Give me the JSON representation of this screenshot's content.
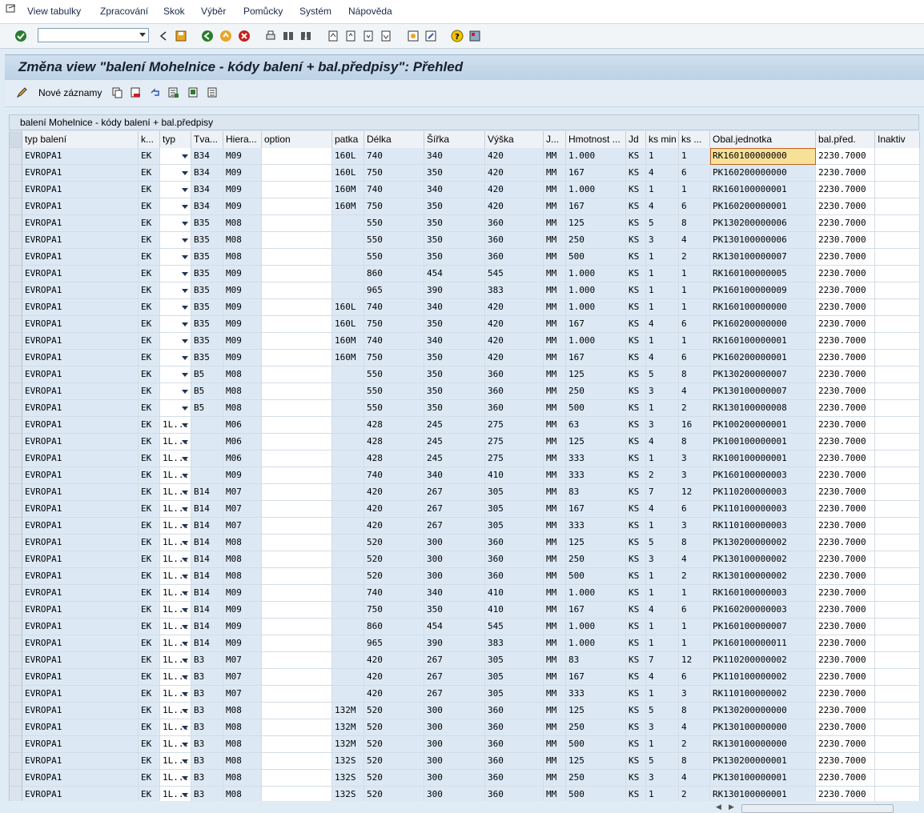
{
  "menu": {
    "items": [
      "View tabulky",
      "Zpracování",
      "Skok",
      "Výběr",
      "Pomůcky",
      "Systém",
      "Nápověda"
    ]
  },
  "toolbar": {
    "command_value": "",
    "icons": [
      "enter-icon",
      "back-icon",
      "save-icon",
      "back-nav-icon",
      "exit-icon",
      "cancel-icon",
      "print-icon",
      "find-icon",
      "find-next-icon",
      "first-page-icon",
      "prev-page-icon",
      "next-page-icon",
      "last-page-icon",
      "create-session-icon",
      "shortcut-icon",
      "help-icon",
      "customize-layout-icon"
    ]
  },
  "title": "Změna view \"balení Mohelnice - kódy balení + bal.předpisy\": Přehled",
  "app_toolbar": {
    "new_entries_label": "Nové záznamy"
  },
  "grid": {
    "title": "balení Mohelnice - kódy balení + bal.předpisy",
    "headers": [
      "typ balení",
      "k...",
      "typ",
      "Tva...",
      "Hiera...",
      "option",
      "patka",
      "Délka",
      "Šířka",
      "Výška",
      "J...",
      "Hmotnost ...",
      "Jd",
      "ks min",
      "ks ...",
      "Obal.jednotka",
      "bal.před.",
      "Inaktiv"
    ],
    "rows": [
      [
        "EVROPA1",
        "EK",
        "",
        "B34",
        "M09",
        "",
        "160L",
        "740",
        "340",
        "420",
        "MM",
        "1.000",
        "KS",
        "1",
        "1",
        "RK160100000000",
        "2230.7000",
        ""
      ],
      [
        "EVROPA1",
        "EK",
        "",
        "B34",
        "M09",
        "",
        "160L",
        "750",
        "350",
        "420",
        "MM",
        "167",
        "KS",
        "4",
        "6",
        "PK160200000000",
        "2230.7000",
        ""
      ],
      [
        "EVROPA1",
        "EK",
        "",
        "B34",
        "M09",
        "",
        "160M",
        "740",
        "340",
        "420",
        "MM",
        "1.000",
        "KS",
        "1",
        "1",
        "RK160100000001",
        "2230.7000",
        ""
      ],
      [
        "EVROPA1",
        "EK",
        "",
        "B34",
        "M09",
        "",
        "160M",
        "750",
        "350",
        "420",
        "MM",
        "167",
        "KS",
        "4",
        "6",
        "PK160200000001",
        "2230.7000",
        ""
      ],
      [
        "EVROPA1",
        "EK",
        "",
        "B35",
        "M08",
        "",
        "",
        "550",
        "350",
        "360",
        "MM",
        "125",
        "KS",
        "5",
        "8",
        "PK130200000006",
        "2230.7000",
        ""
      ],
      [
        "EVROPA1",
        "EK",
        "",
        "B35",
        "M08",
        "",
        "",
        "550",
        "350",
        "360",
        "MM",
        "250",
        "KS",
        "3",
        "4",
        "PK130100000006",
        "2230.7000",
        ""
      ],
      [
        "EVROPA1",
        "EK",
        "",
        "B35",
        "M08",
        "",
        "",
        "550",
        "350",
        "360",
        "MM",
        "500",
        "KS",
        "1",
        "2",
        "RK130100000007",
        "2230.7000",
        ""
      ],
      [
        "EVROPA1",
        "EK",
        "",
        "B35",
        "M09",
        "",
        "",
        "860",
        "454",
        "545",
        "MM",
        "1.000",
        "KS",
        "1",
        "1",
        "RK160100000005",
        "2230.7000",
        ""
      ],
      [
        "EVROPA1",
        "EK",
        "",
        "B35",
        "M09",
        "",
        "",
        "965",
        "390",
        "383",
        "MM",
        "1.000",
        "KS",
        "1",
        "1",
        "PK160100000009",
        "2230.7000",
        ""
      ],
      [
        "EVROPA1",
        "EK",
        "",
        "B35",
        "M09",
        "",
        "160L",
        "740",
        "340",
        "420",
        "MM",
        "1.000",
        "KS",
        "1",
        "1",
        "RK160100000000",
        "2230.7000",
        ""
      ],
      [
        "EVROPA1",
        "EK",
        "",
        "B35",
        "M09",
        "",
        "160L",
        "750",
        "350",
        "420",
        "MM",
        "167",
        "KS",
        "4",
        "6",
        "PK160200000000",
        "2230.7000",
        ""
      ],
      [
        "EVROPA1",
        "EK",
        "",
        "B35",
        "M09",
        "",
        "160M",
        "740",
        "340",
        "420",
        "MM",
        "1.000",
        "KS",
        "1",
        "1",
        "RK160100000001",
        "2230.7000",
        ""
      ],
      [
        "EVROPA1",
        "EK",
        "",
        "B35",
        "M09",
        "",
        "160M",
        "750",
        "350",
        "420",
        "MM",
        "167",
        "KS",
        "4",
        "6",
        "PK160200000001",
        "2230.7000",
        ""
      ],
      [
        "EVROPA1",
        "EK",
        "",
        "B5",
        "M08",
        "",
        "",
        "550",
        "350",
        "360",
        "MM",
        "125",
        "KS",
        "5",
        "8",
        "PK130200000007",
        "2230.7000",
        ""
      ],
      [
        "EVROPA1",
        "EK",
        "",
        "B5",
        "M08",
        "",
        "",
        "550",
        "350",
        "360",
        "MM",
        "250",
        "KS",
        "3",
        "4",
        "PK130100000007",
        "2230.7000",
        ""
      ],
      [
        "EVROPA1",
        "EK",
        "",
        "B5",
        "M08",
        "",
        "",
        "550",
        "350",
        "360",
        "MM",
        "500",
        "KS",
        "1",
        "2",
        "RK130100000008",
        "2230.7000",
        ""
      ],
      [
        "EVROPA1",
        "EK",
        "1L...",
        "",
        "M06",
        "",
        "",
        "428",
        "245",
        "275",
        "MM",
        "63",
        "KS",
        "3",
        "16",
        "PK100200000001",
        "2230.7000",
        ""
      ],
      [
        "EVROPA1",
        "EK",
        "1L...",
        "",
        "M06",
        "",
        "",
        "428",
        "245",
        "275",
        "MM",
        "125",
        "KS",
        "4",
        "8",
        "PK100100000001",
        "2230.7000",
        ""
      ],
      [
        "EVROPA1",
        "EK",
        "1L...",
        "",
        "M06",
        "",
        "",
        "428",
        "245",
        "275",
        "MM",
        "333",
        "KS",
        "1",
        "3",
        "RK100100000001",
        "2230.7000",
        ""
      ],
      [
        "EVROPA1",
        "EK",
        "1L...",
        "",
        "M09",
        "",
        "",
        "740",
        "340",
        "410",
        "MM",
        "333",
        "KS",
        "2",
        "3",
        "PK160100000003",
        "2230.7000",
        ""
      ],
      [
        "EVROPA1",
        "EK",
        "1L...",
        "B14",
        "M07",
        "",
        "",
        "420",
        "267",
        "305",
        "MM",
        "83",
        "KS",
        "7",
        "12",
        "PK110200000003",
        "2230.7000",
        ""
      ],
      [
        "EVROPA1",
        "EK",
        "1L...",
        "B14",
        "M07",
        "",
        "",
        "420",
        "267",
        "305",
        "MM",
        "167",
        "KS",
        "4",
        "6",
        "PK110100000003",
        "2230.7000",
        ""
      ],
      [
        "EVROPA1",
        "EK",
        "1L...",
        "B14",
        "M07",
        "",
        "",
        "420",
        "267",
        "305",
        "MM",
        "333",
        "KS",
        "1",
        "3",
        "RK110100000003",
        "2230.7000",
        ""
      ],
      [
        "EVROPA1",
        "EK",
        "1L...",
        "B14",
        "M08",
        "",
        "",
        "520",
        "300",
        "360",
        "MM",
        "125",
        "KS",
        "5",
        "8",
        "PK130200000002",
        "2230.7000",
        ""
      ],
      [
        "EVROPA1",
        "EK",
        "1L...",
        "B14",
        "M08",
        "",
        "",
        "520",
        "300",
        "360",
        "MM",
        "250",
        "KS",
        "3",
        "4",
        "PK130100000002",
        "2230.7000",
        ""
      ],
      [
        "EVROPA1",
        "EK",
        "1L...",
        "B14",
        "M08",
        "",
        "",
        "520",
        "300",
        "360",
        "MM",
        "500",
        "KS",
        "1",
        "2",
        "RK130100000002",
        "2230.7000",
        ""
      ],
      [
        "EVROPA1",
        "EK",
        "1L...",
        "B14",
        "M09",
        "",
        "",
        "740",
        "340",
        "410",
        "MM",
        "1.000",
        "KS",
        "1",
        "1",
        "RK160100000003",
        "2230.7000",
        ""
      ],
      [
        "EVROPA1",
        "EK",
        "1L...",
        "B14",
        "M09",
        "",
        "",
        "750",
        "350",
        "410",
        "MM",
        "167",
        "KS",
        "4",
        "6",
        "PK160200000003",
        "2230.7000",
        ""
      ],
      [
        "EVROPA1",
        "EK",
        "1L...",
        "B14",
        "M09",
        "",
        "",
        "860",
        "454",
        "545",
        "MM",
        "1.000",
        "KS",
        "1",
        "1",
        "PK160100000007",
        "2230.7000",
        ""
      ],
      [
        "EVROPA1",
        "EK",
        "1L...",
        "B14",
        "M09",
        "",
        "",
        "965",
        "390",
        "383",
        "MM",
        "1.000",
        "KS",
        "1",
        "1",
        "PK160100000011",
        "2230.7000",
        ""
      ],
      [
        "EVROPA1",
        "EK",
        "1L...",
        "B3",
        "M07",
        "",
        "",
        "420",
        "267",
        "305",
        "MM",
        "83",
        "KS",
        "7",
        "12",
        "PK110200000002",
        "2230.7000",
        ""
      ],
      [
        "EVROPA1",
        "EK",
        "1L...",
        "B3",
        "M07",
        "",
        "",
        "420",
        "267",
        "305",
        "MM",
        "167",
        "KS",
        "4",
        "6",
        "PK110100000002",
        "2230.7000",
        ""
      ],
      [
        "EVROPA1",
        "EK",
        "1L...",
        "B3",
        "M07",
        "",
        "",
        "420",
        "267",
        "305",
        "MM",
        "333",
        "KS",
        "1",
        "3",
        "RK110100000002",
        "2230.7000",
        ""
      ],
      [
        "EVROPA1",
        "EK",
        "1L...",
        "B3",
        "M08",
        "",
        "132M",
        "520",
        "300",
        "360",
        "MM",
        "125",
        "KS",
        "5",
        "8",
        "PK130200000000",
        "2230.7000",
        ""
      ],
      [
        "EVROPA1",
        "EK",
        "1L...",
        "B3",
        "M08",
        "",
        "132M",
        "520",
        "300",
        "360",
        "MM",
        "250",
        "KS",
        "3",
        "4",
        "PK130100000000",
        "2230.7000",
        ""
      ],
      [
        "EVROPA1",
        "EK",
        "1L...",
        "B3",
        "M08",
        "",
        "132M",
        "520",
        "300",
        "360",
        "MM",
        "500",
        "KS",
        "1",
        "2",
        "RK130100000000",
        "2230.7000",
        ""
      ],
      [
        "EVROPA1",
        "EK",
        "1L...",
        "B3",
        "M08",
        "",
        "132S",
        "520",
        "300",
        "360",
        "MM",
        "125",
        "KS",
        "5",
        "8",
        "PK130200000001",
        "2230.7000",
        ""
      ],
      [
        "EVROPA1",
        "EK",
        "1L...",
        "B3",
        "M08",
        "",
        "132S",
        "520",
        "300",
        "360",
        "MM",
        "250",
        "KS",
        "3",
        "4",
        "PK130100000001",
        "2230.7000",
        ""
      ],
      [
        "EVROPA1",
        "EK",
        "1L...",
        "B3",
        "M08",
        "",
        "132S",
        "520",
        "300",
        "360",
        "MM",
        "500",
        "KS",
        "1",
        "2",
        "RK130100000001",
        "2230.7000",
        ""
      ]
    ],
    "selected_row": 0,
    "selected_col": 15
  }
}
